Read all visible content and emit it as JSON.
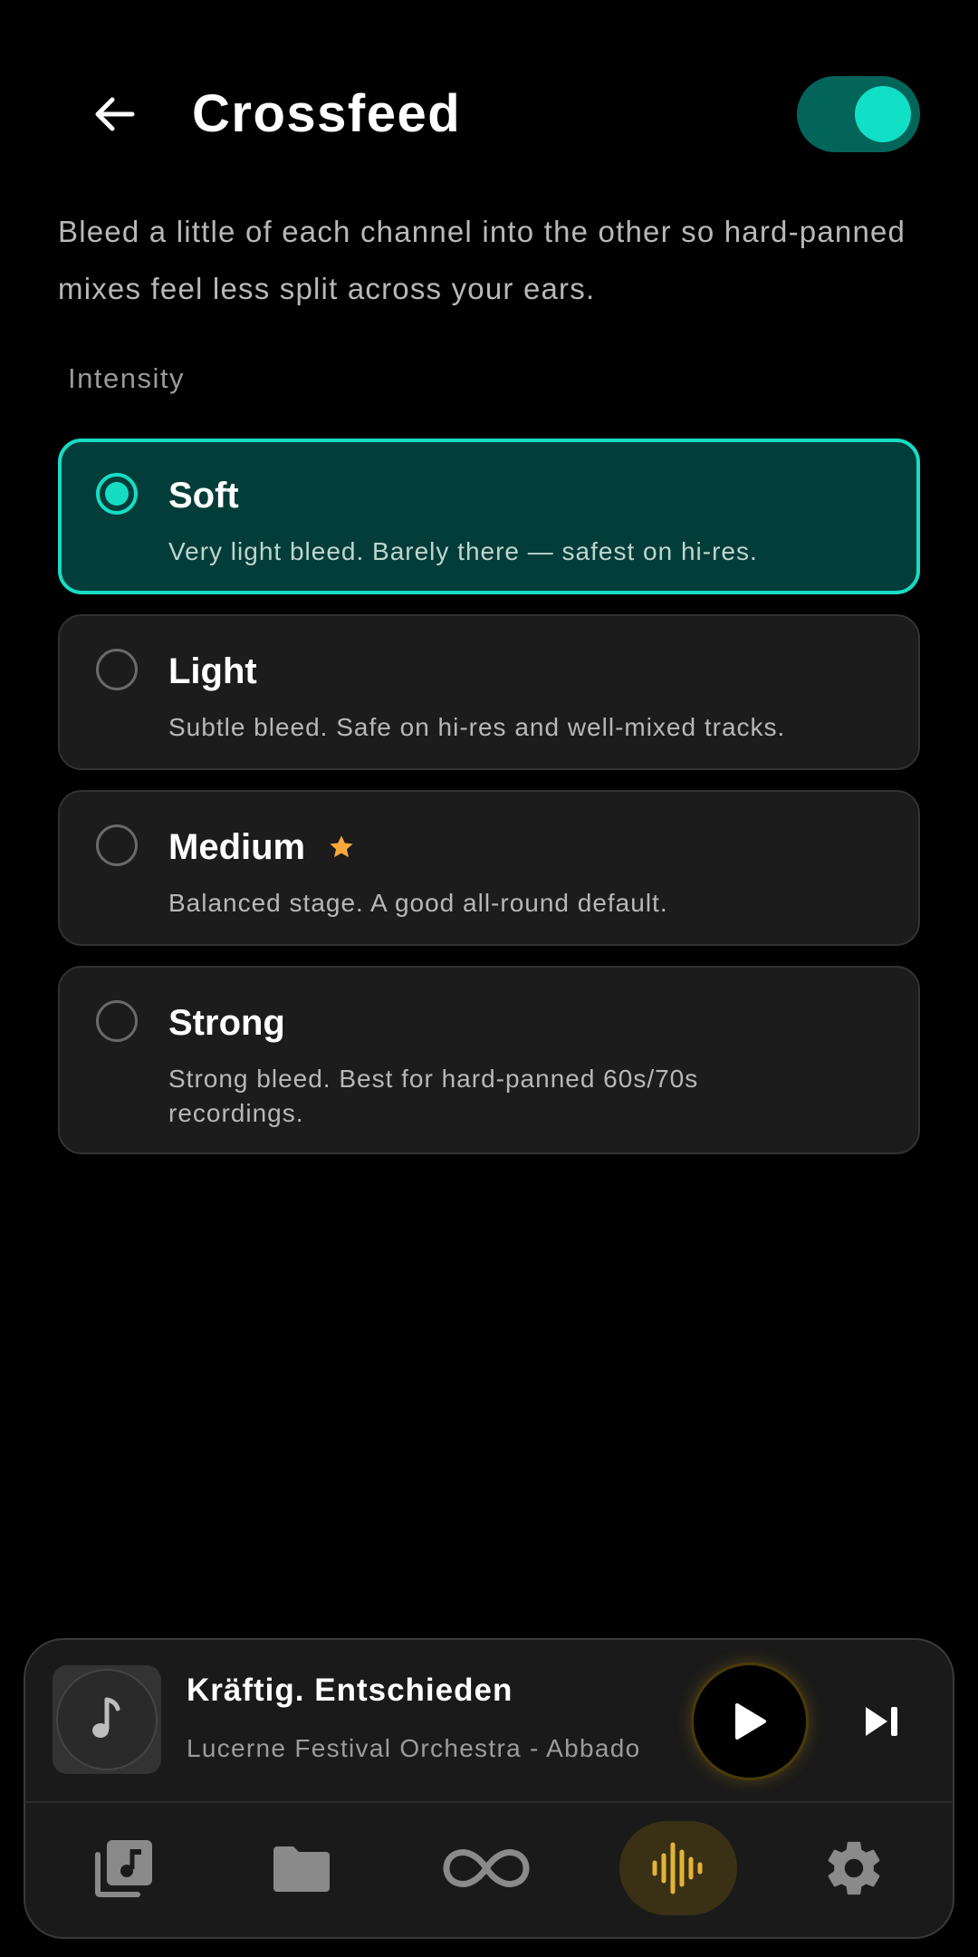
{
  "header": {
    "title": "Crossfeed",
    "toggle_on": true
  },
  "description": "Bleed a little of each channel into the other so hard-panned mixes feel less split across your ears.",
  "section_label": "Intensity",
  "options": [
    {
      "title": "Soft",
      "desc": "Very light bleed. Barely there — safest on hi-res.",
      "selected": true
    },
    {
      "title": "Light",
      "desc": "Subtle bleed. Safe on hi-res and well-mixed tracks.",
      "selected": false
    },
    {
      "title": "Medium",
      "desc": "Balanced stage. A good all-round default.",
      "selected": false,
      "recommended_icon": "star-icon"
    },
    {
      "title": "Strong",
      "desc": "Strong bleed. Best for hard-panned 60s/70s recordings.",
      "selected": false
    }
  ],
  "player": {
    "track_title": "Kräftig. Entschieden",
    "track_artist": "Lucerne Festival Orchestra - Abbado"
  },
  "nav": [
    {
      "icon": "library-icon",
      "active": false
    },
    {
      "icon": "folder-icon",
      "active": false
    },
    {
      "icon": "infinity-icon",
      "active": false
    },
    {
      "icon": "waveform-icon",
      "active": true
    },
    {
      "icon": "settings-gear-icon",
      "active": false
    }
  ],
  "colors": {
    "accent": "#17dcc4",
    "selected_card_bg": "#023d39",
    "card_bg": "#1c1c1c",
    "star": "#f5a93a",
    "nav_active": "#e2b33a"
  }
}
